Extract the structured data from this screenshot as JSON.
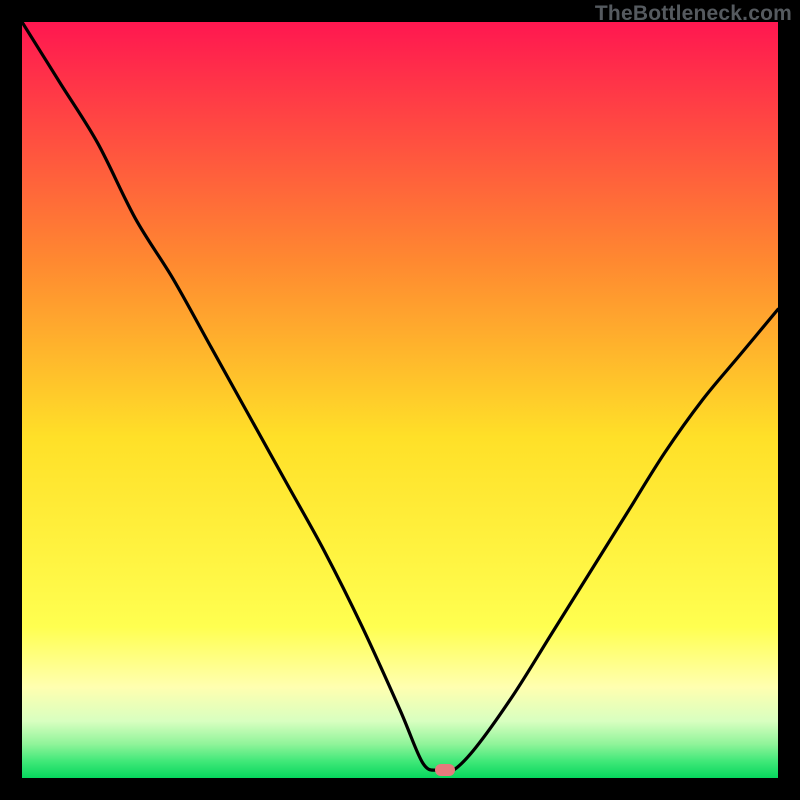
{
  "watermark": "TheBottleneck.com",
  "colors": {
    "red_top": "#ff1750",
    "orange": "#ff9a2b",
    "yellow": "#fff02a",
    "yellow_pale": "#ffff9d",
    "green_pale": "#b8ffb0",
    "green_mid": "#66f07a",
    "green_deep": "#06d65d",
    "curve": "#000000",
    "marker": "#e67a7d",
    "background": "#000000"
  },
  "chart_data": {
    "type": "line",
    "title": "",
    "xlabel": "",
    "ylabel": "",
    "xlim": [
      0,
      100
    ],
    "ylim": [
      0,
      100
    ],
    "grid": false,
    "series": [
      {
        "name": "curve",
        "x": [
          0,
          5,
          10,
          15,
          20,
          25,
          30,
          35,
          40,
          45,
          50,
          53,
          55,
          57,
          60,
          65,
          70,
          75,
          80,
          85,
          90,
          95,
          100
        ],
        "y": [
          100,
          92,
          84,
          74,
          66,
          57,
          48,
          39,
          30,
          20,
          9,
          2,
          1,
          1,
          4,
          11,
          19,
          27,
          35,
          43,
          50,
          56,
          62
        ]
      }
    ],
    "marker": {
      "x": 56,
      "y": 1
    },
    "gradient_stops": [
      {
        "pos": 0.0,
        "color": "#ff1750"
      },
      {
        "pos": 0.32,
        "color": "#ff8a30"
      },
      {
        "pos": 0.55,
        "color": "#ffe028"
      },
      {
        "pos": 0.8,
        "color": "#ffff50"
      },
      {
        "pos": 0.88,
        "color": "#ffffb0"
      },
      {
        "pos": 0.925,
        "color": "#d8ffc0"
      },
      {
        "pos": 0.955,
        "color": "#90f49a"
      },
      {
        "pos": 0.978,
        "color": "#40e878"
      },
      {
        "pos": 1.0,
        "color": "#06d65d"
      }
    ]
  }
}
